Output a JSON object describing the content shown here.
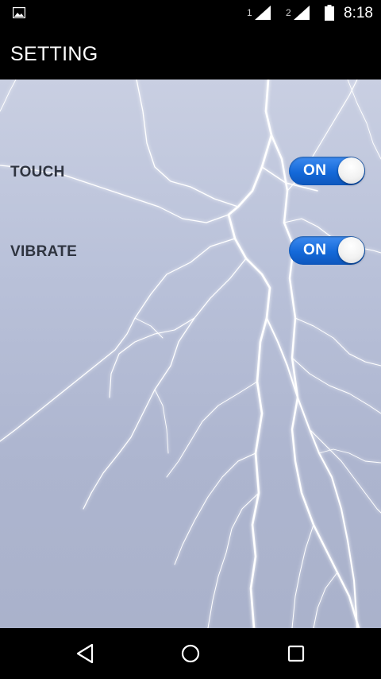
{
  "status_bar": {
    "sim1": "1",
    "sim2": "2",
    "time": "8:18",
    "icons": [
      "gallery-icon",
      "signal-icon",
      "signal-icon",
      "battery-icon"
    ]
  },
  "app_bar": {
    "title": "SETTING"
  },
  "settings": [
    {
      "label": "TOUCH",
      "state": "ON"
    },
    {
      "label": "VIBRATE",
      "state": "ON"
    }
  ],
  "nav_bar": {
    "icons": [
      "back-icon",
      "home-icon",
      "recents-icon"
    ]
  },
  "colors": {
    "toggle_on": "#1469d9",
    "label": "#2f3440",
    "sky": "#b9c1d9"
  }
}
